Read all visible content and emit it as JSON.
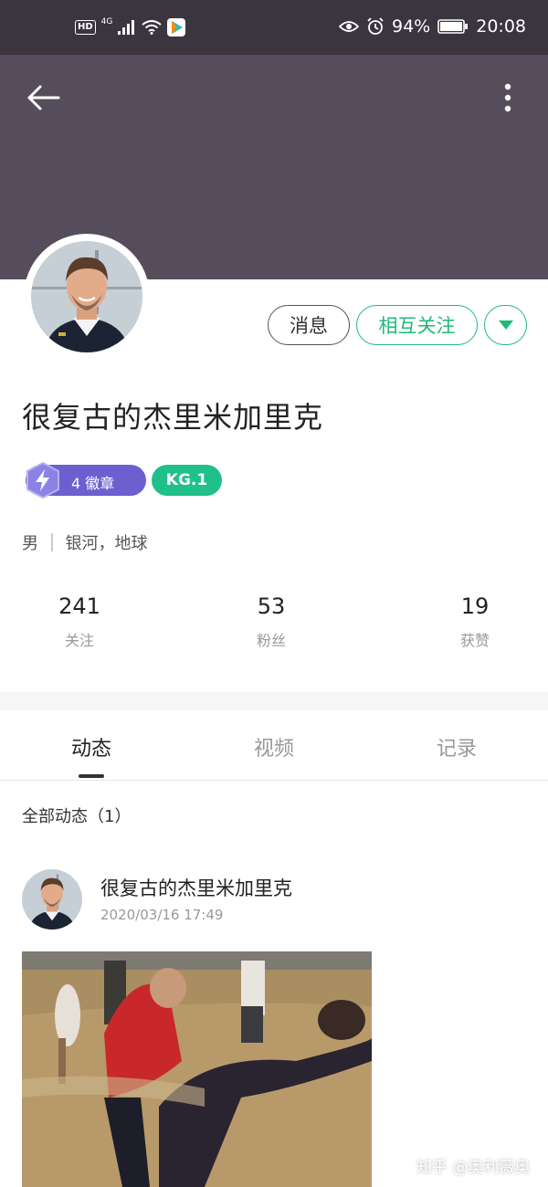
{
  "status_bar": {
    "hd": "HD",
    "network": "4G",
    "battery": "94%",
    "time": "20:08",
    "icons": [
      "signal-icon",
      "wifi-icon",
      "video-app-icon",
      "eye-icon",
      "alarm-icon",
      "battery-icon"
    ]
  },
  "header": {
    "back_icon": "back-arrow-icon",
    "more_icon": "more-vertical-icon",
    "bg_color": "#554d5c"
  },
  "actions": {
    "message_label": "消息",
    "follow_label": "相互关注",
    "dropdown_icon": "caret-down-icon",
    "accent_color": "#1fb97a"
  },
  "profile": {
    "name": "很复古的杰里米加里克",
    "badge_label": "4 徽章",
    "badge_color": "#6d5fd0",
    "level_label": "KG.1",
    "level_color": "#1fc08a",
    "gender": "男",
    "location": "银河，地球"
  },
  "stats": [
    {
      "value": "241",
      "label": "关注"
    },
    {
      "value": "53",
      "label": "粉丝"
    },
    {
      "value": "19",
      "label": "获赞"
    }
  ],
  "tabs": [
    {
      "label": "动态",
      "active": true
    },
    {
      "label": "视频",
      "active": false
    },
    {
      "label": "记录",
      "active": false
    }
  ],
  "feed": {
    "section_title": "全部动态（1）",
    "posts": [
      {
        "author": "很复古的杰里米加里克",
        "time": "2020/03/16 17:49"
      }
    ]
  },
  "watermark": "知乎 @奥利薇奥"
}
